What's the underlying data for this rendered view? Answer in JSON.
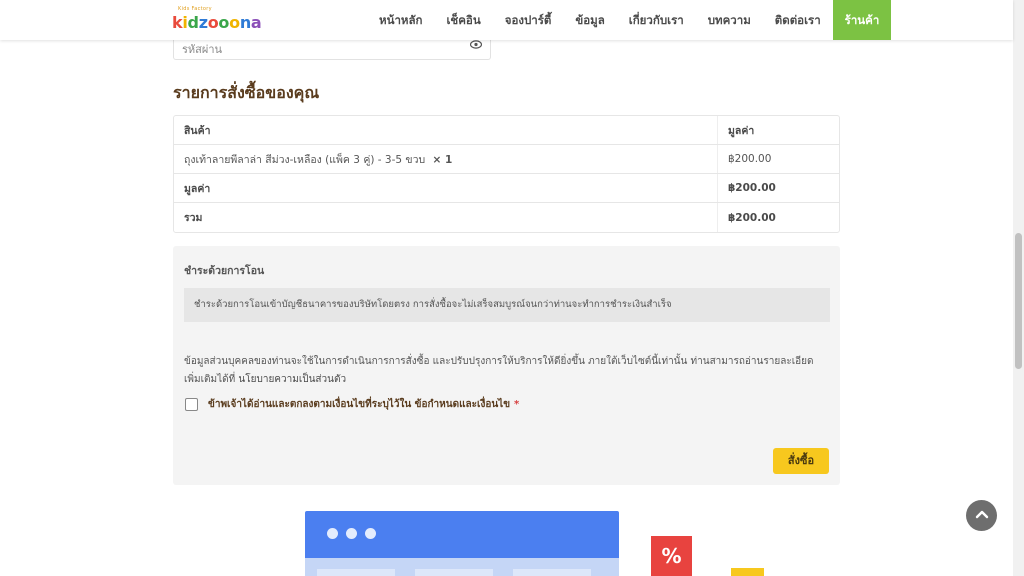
{
  "logo": {
    "tagline": "Kids Factory",
    "text": "kidzooona"
  },
  "nav": {
    "items": [
      {
        "label": "หน้าหลัก"
      },
      {
        "label": "เช็คอิน"
      },
      {
        "label": "จองปาร์ตี้"
      },
      {
        "label": "ข้อมูล"
      },
      {
        "label": "เกี่ยวกับเรา"
      },
      {
        "label": "บทความ"
      },
      {
        "label": "ติดต่อเรา"
      },
      {
        "label": "ร้านค้า"
      }
    ],
    "active_index": 7,
    "active_color": "#7cc243"
  },
  "password_field": {
    "placeholder": "รหัสผ่าน",
    "icon": "eye-icon"
  },
  "order": {
    "title": "รายการสั่งซื้อของคุณ",
    "headers": {
      "product": "สินค้า",
      "value": "มูลค่า"
    },
    "items": [
      {
        "name": "ถุงเท้าลายพีลาล่า สีม่วง-เหลือง (แพ็ค 3 คู่) - 3-5 ขวบ",
        "qty": "× 1",
        "price": "฿200.00"
      }
    ],
    "subtotal": {
      "label": "มูลค่า",
      "value": "฿200.00"
    },
    "total": {
      "label": "รวม",
      "value": "฿200.00"
    }
  },
  "payment": {
    "method": "ชำระด้วยการโอน",
    "description": "ชำระด้วยการโอนเข้าบัญชีธนาคารของบริษัทโดยตรง การสั่งซื้อจะไม่เสร็จสมบูรณ์จนกว่าท่านจะทำการชำระเงินสำเร็จ",
    "privacy_text": "ข้อมูลส่วนบุคคลของท่านจะใช้ในการดำเนินการการสั่งซื้อ และปรับปรุงการให้บริการให้ดียิ่งขึ้น ภายใต้เว็บไซต์นี้เท่านั้น ท่านสามารถอ่านรายละเอียดเพิ่มเติมได้ที่",
    "privacy_link": "นโยบายความเป็นส่วนตัว",
    "terms_label": "ข้าพเจ้าได้อ่านและตกลงตามเงื่อนไขที่ระบุไว้ใน ข้อกำหนดและเงื่อนไข",
    "terms_required": "*",
    "terms_checked": false,
    "buy_button": "สั่งซื้อ",
    "button_color": "#f7c81e"
  },
  "promo": {
    "percent_label": "%"
  }
}
